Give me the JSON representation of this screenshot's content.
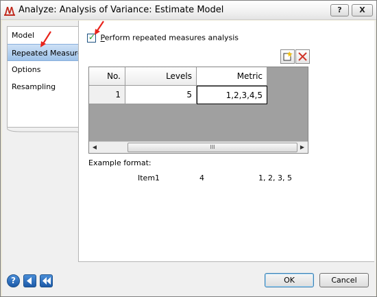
{
  "window": {
    "title": "Analyze: Analysis of Variance: Estimate Model",
    "help_glyph": "?",
    "close_glyph": "X"
  },
  "nav": {
    "items": [
      {
        "label": "Model",
        "active": false
      },
      {
        "label": "Repeated Measures",
        "active": true
      },
      {
        "label": "Options",
        "active": false
      },
      {
        "label": "Resampling",
        "active": false
      }
    ]
  },
  "repeated": {
    "checkbox_label": "Perform repeated measures analysis",
    "checkbox_checked": true
  },
  "grid": {
    "headers": [
      "No.",
      "Levels",
      "Metric"
    ],
    "rows": [
      {
        "no": "1",
        "levels": "5",
        "metric": "1,2,3,4,5"
      }
    ],
    "scroll_thumb_glyph": "III"
  },
  "example": {
    "title": "Example format:",
    "item": "Item1",
    "levels": "4",
    "metric": "1, 2, 3, 5"
  },
  "buttons": {
    "ok": "OK",
    "cancel": "Cancel"
  },
  "colors": {
    "annotation_arrow": "#e8231b",
    "nav_active": "#9fc3ea"
  }
}
